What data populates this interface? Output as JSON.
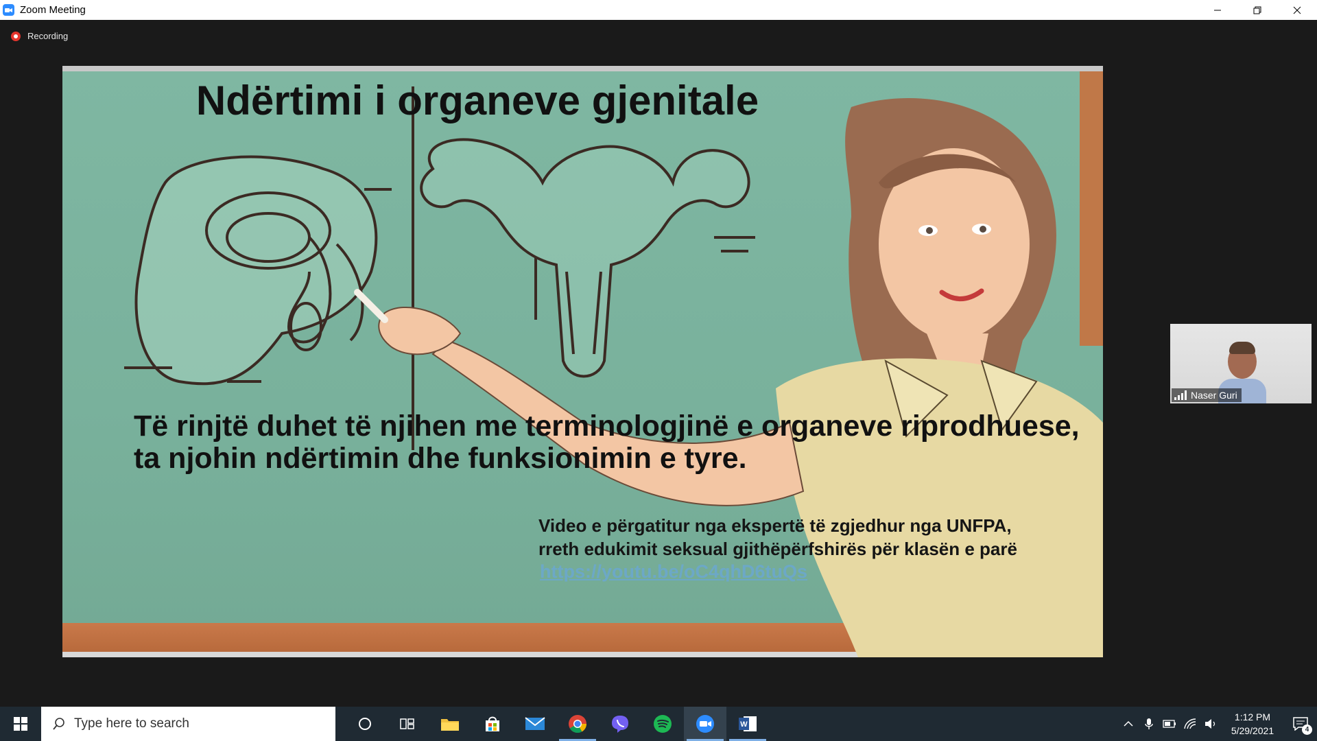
{
  "window": {
    "title": "Zoom Meeting",
    "app_icon": "zoom-camera-icon"
  },
  "meeting": {
    "recording_label": "Recording",
    "slide": {
      "title": "Ndërtimi i organeve gjenitale",
      "body": "Të rinjtë duhet të njihen me terminologjinë e organeve riprodhuese, ta njohin ndërtimin dhe funksionimin e tyre.",
      "credit_line_1": "Video e përgatitur nga ekspertë të zgjedhur nga UNFPA,",
      "credit_line_2": "rreth edukimit seksual gjithëpërfshirës për klasën e parë",
      "link": "https://youtu.be/oC4qhD6tuQs"
    },
    "participant": {
      "name": "Naser Guri"
    }
  },
  "taskbar": {
    "search_placeholder": "Type here to search",
    "apps": [
      "cortana-icon",
      "task-view-icon",
      "file-explorer-icon",
      "store-icon",
      "mail-icon",
      "chrome-icon",
      "viber-icon",
      "spotify-icon",
      "zoom-icon",
      "word-icon"
    ],
    "clock": {
      "time": "1:12 PM",
      "date": "5/29/2021"
    },
    "notification_count": "4"
  },
  "colors": {
    "zoom_blue": "#2D8CFF",
    "recording_red": "#e5352d",
    "board_green": "#7fb7a2",
    "taskbar_bg": "#1f2a33"
  }
}
